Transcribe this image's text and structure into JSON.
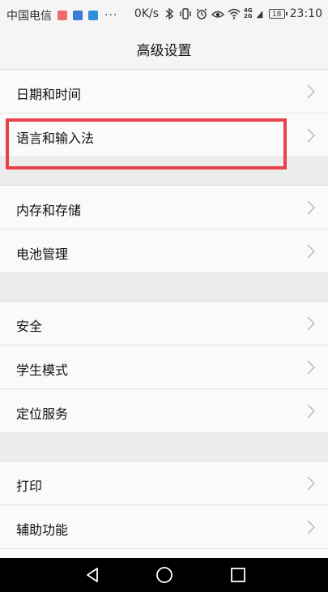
{
  "status_bar": {
    "carrier": "中国电信",
    "more_indicator": "···",
    "network_speed": "0K/s",
    "network_type_top": "4G",
    "network_type_bottom": "2G",
    "battery_level": "18",
    "time": "23:10"
  },
  "header": {
    "title": "高级设置"
  },
  "sections": [
    {
      "items": [
        {
          "label": "日期和时间"
        },
        {
          "label": "语言和输入法"
        }
      ]
    },
    {
      "items": [
        {
          "label": "内存和存储"
        },
        {
          "label": "电池管理"
        }
      ]
    },
    {
      "items": [
        {
          "label": "安全"
        },
        {
          "label": "学生模式"
        },
        {
          "label": "定位服务"
        }
      ]
    },
    {
      "items": [
        {
          "label": "打印"
        },
        {
          "label": "辅助功能"
        }
      ]
    }
  ],
  "colors": {
    "highlight": "#e84149",
    "nav_bar": "#000000"
  }
}
